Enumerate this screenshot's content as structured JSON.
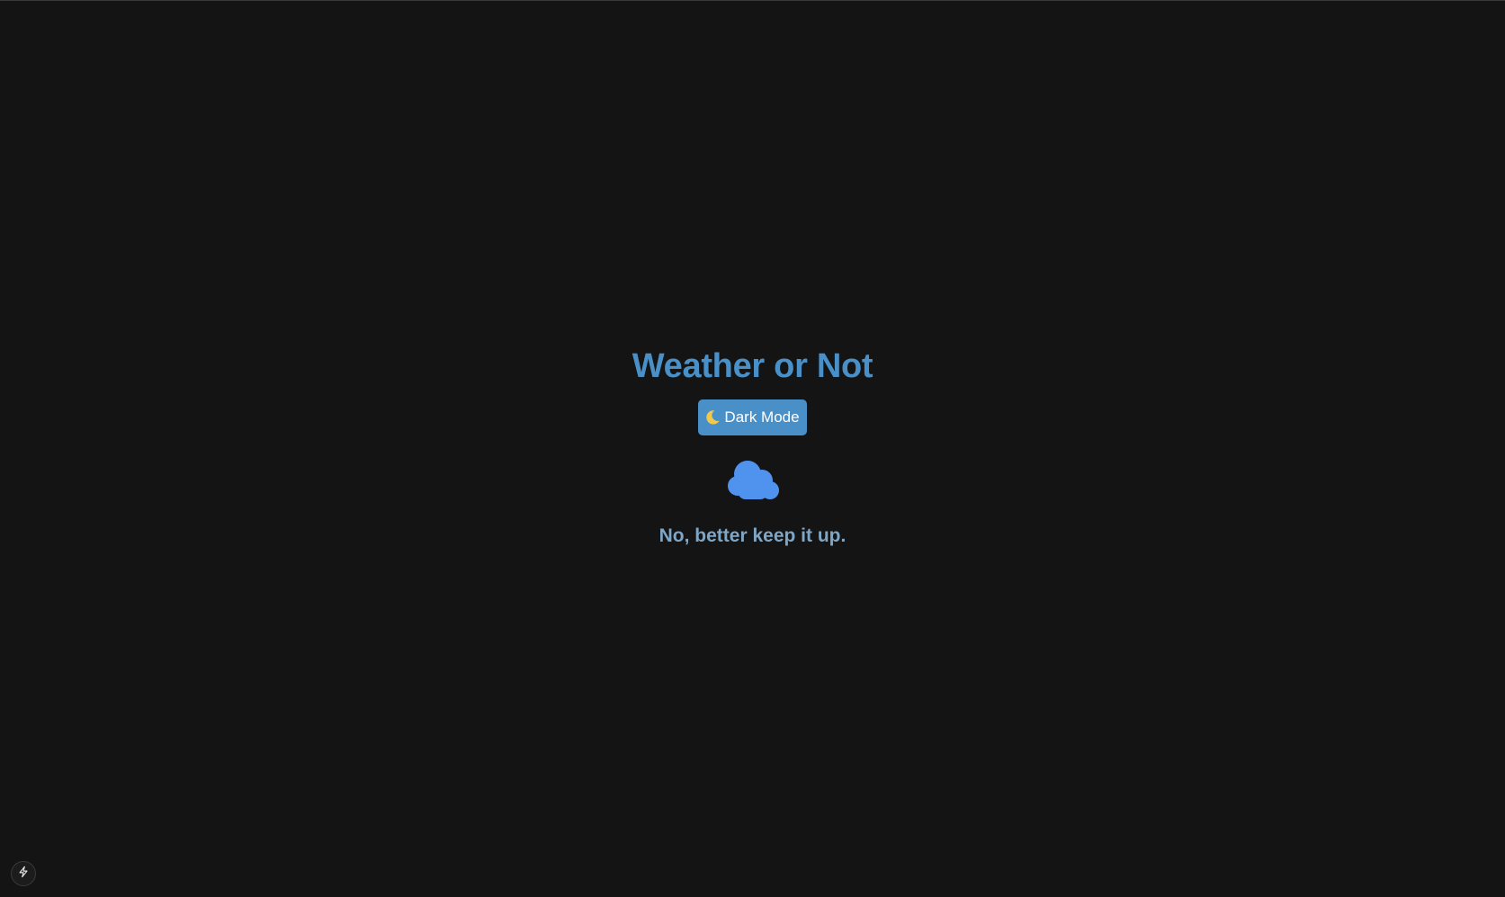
{
  "app": {
    "title": "Weather or Not"
  },
  "theme_toggle": {
    "label": "Dark Mode",
    "icon": "moon-icon"
  },
  "weather": {
    "icon": "cloud-icon",
    "answer": "No, better keep it up."
  },
  "corner_button": {
    "icon": "lightning-bolt-icon"
  },
  "colors": {
    "background": "#141414",
    "accent": "#4a90c8",
    "cloud": "#4f93ef",
    "answer_text": "#7ea6c6"
  }
}
